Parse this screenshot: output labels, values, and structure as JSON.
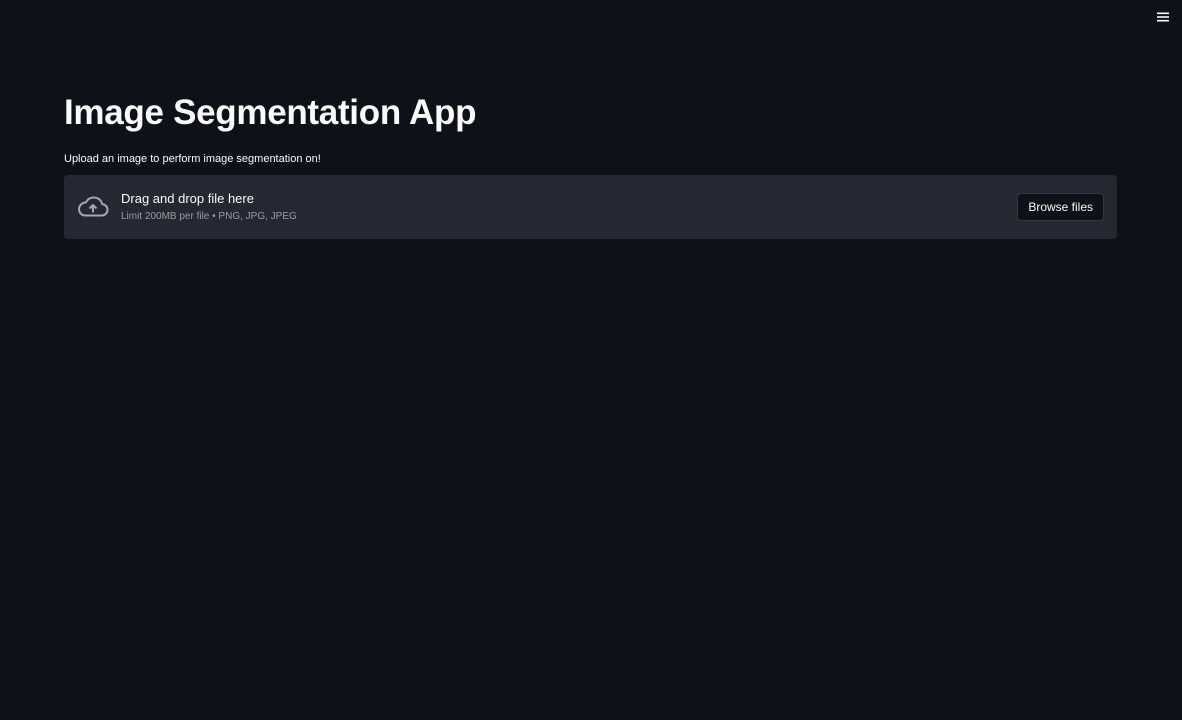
{
  "header": {
    "menu_icon": "hamburger-menu-icon"
  },
  "main": {
    "title": "Image Segmentation App",
    "description": "Upload an image to perform image segmentation on!"
  },
  "uploader": {
    "icon": "cloud-upload-icon",
    "drag_text": "Drag and drop file here",
    "limit_text": "Limit 200MB per file • PNG, JPG, JPEG",
    "browse_label": "Browse files"
  },
  "colors": {
    "background": "#0e1117",
    "uploader_background": "#262730",
    "text": "#fafafa",
    "muted_text": "#9a9ca3"
  }
}
